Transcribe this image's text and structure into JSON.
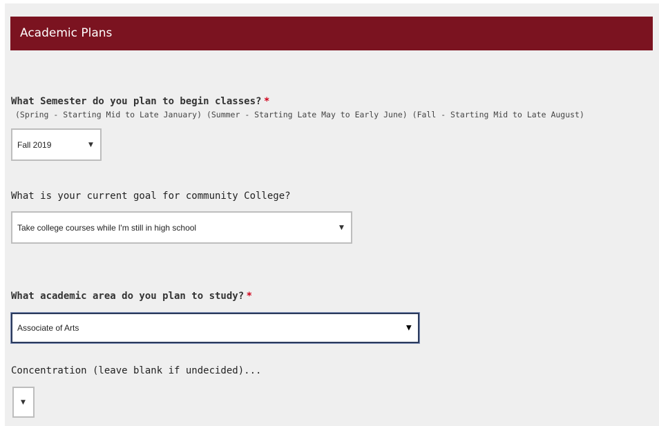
{
  "section": {
    "title": "Academic Plans"
  },
  "semester": {
    "label": "What Semester do you plan to begin classes?",
    "required_mark": "*",
    "hint": "(Spring - Starting Mid to Late January) (Summer - Starting Late May to Early June) (Fall - Starting Mid to Late August)",
    "selected": "Fall 2019",
    "arrow": "▼"
  },
  "goal": {
    "label": "What is your current goal for community College?",
    "selected": "Take college courses while I'm still in high school",
    "arrow": "▼"
  },
  "area": {
    "label": "What academic area do you plan to study?",
    "required_mark": "*",
    "selected": "Associate of Arts",
    "arrow": "▼"
  },
  "concentration": {
    "label": "Concentration (leave blank if undecided)...",
    "selected": "",
    "arrow": "▼"
  },
  "colors": {
    "header_bg": "#7b1320",
    "panel_bg": "#efefef",
    "required": "#d0021b",
    "focus_border": "#2b3a5c"
  }
}
